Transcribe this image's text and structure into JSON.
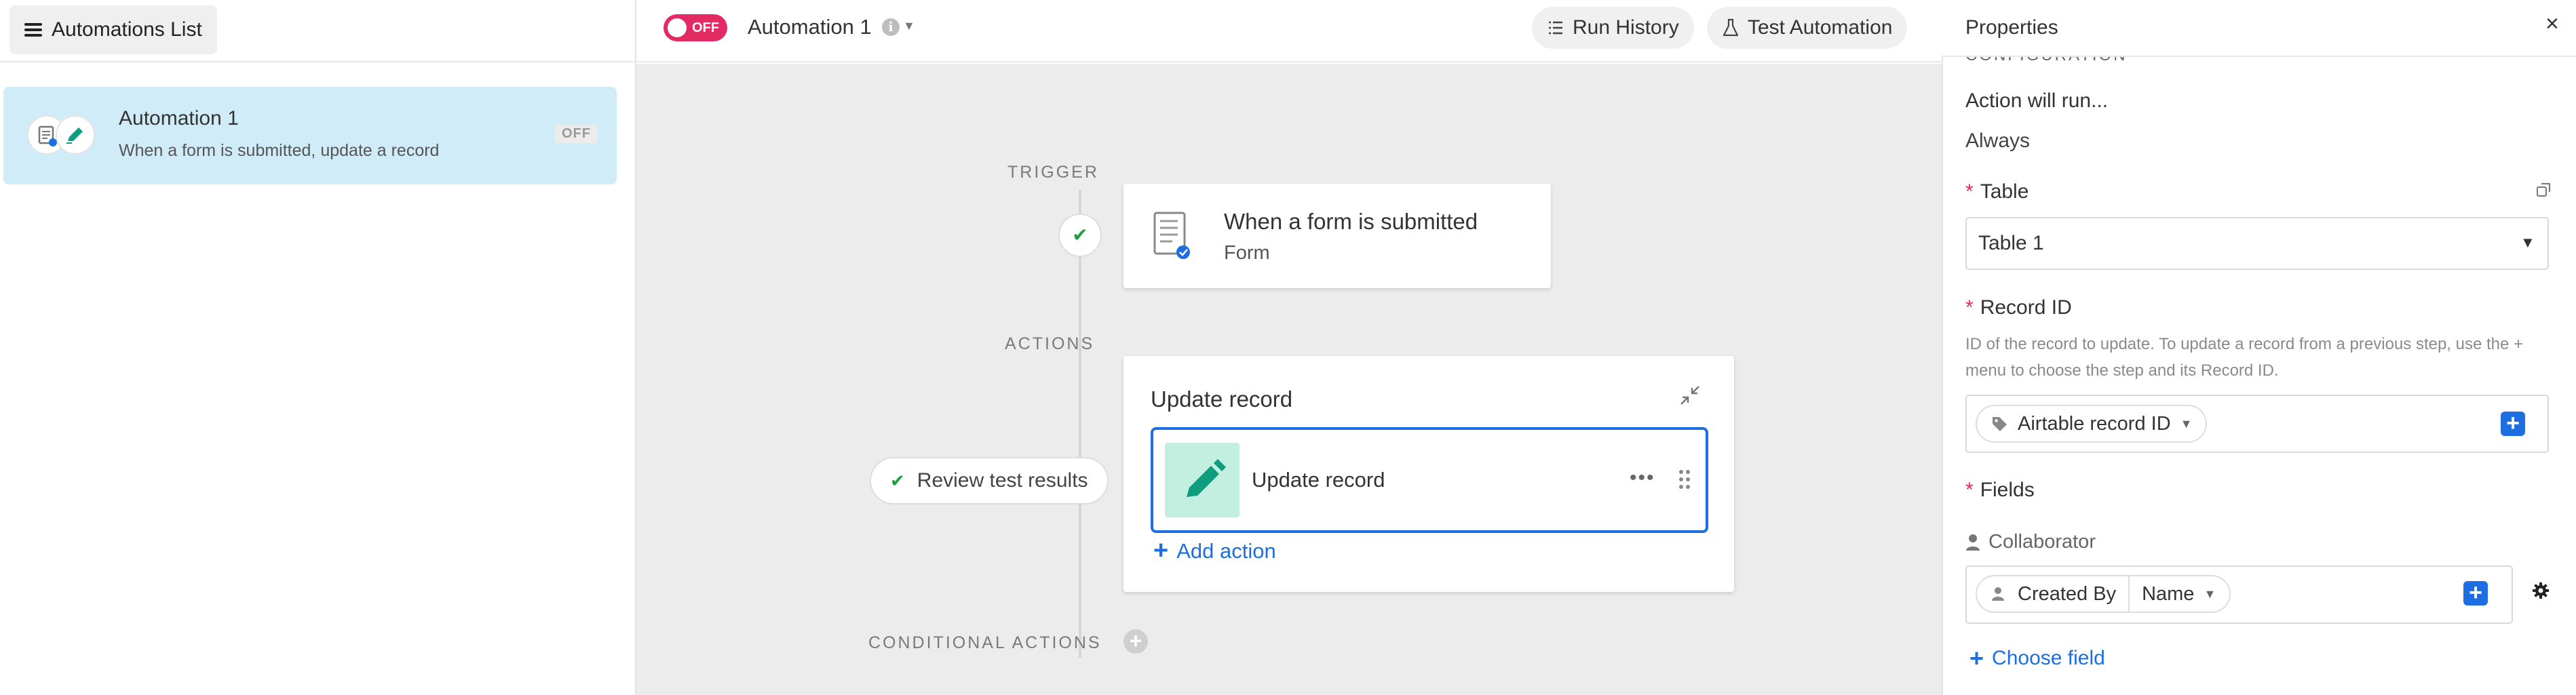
{
  "sidebar": {
    "list_button_label": "Automations List",
    "item": {
      "title": "Automation 1",
      "description": "When a form is submitted, update a record",
      "status_badge": "OFF"
    }
  },
  "topbar": {
    "toggle_label": "OFF",
    "automation_name": "Automation 1",
    "info_glyph": "i",
    "run_history_label": "Run History",
    "test_automation_label": "Test Automation"
  },
  "canvas": {
    "trigger_section": "TRIGGER",
    "actions_section": "ACTIONS",
    "conditional_section": "CONDITIONAL ACTIONS",
    "trigger_card": {
      "title": "When a form is submitted",
      "subtitle": "Form"
    },
    "review_button": "Review test results",
    "action_card": {
      "title": "Update record",
      "step_label": "Update record",
      "more_glyph": "•••"
    },
    "add_action_label": "Add action"
  },
  "properties": {
    "title": "Properties",
    "close_glyph": "×",
    "configuration_label": "CONFIGURATION",
    "action_run_label": "Action will run...",
    "action_run_value": "Always",
    "table": {
      "label": "Table",
      "value": "Table 1"
    },
    "record_id": {
      "label": "Record ID",
      "help": "ID of the record to update. To update a record from a previous step, use the + menu to choose the step and its Record ID.",
      "pill_label": "Airtable record ID"
    },
    "fields": {
      "label": "Fields",
      "collaborator_label": "Collaborator",
      "pill_label": "Created By",
      "pill_sub_label": "Name"
    },
    "choose_field_label": "Choose field",
    "required_mark": "*"
  },
  "colors": {
    "accent_blue": "#1d6ee1",
    "off_pink": "#e42a63",
    "selected_item_bg": "#d1ecf9",
    "success_green": "#1e9e3e",
    "pencil_tile_bg": "#c3efe0",
    "pencil_icon": "#0e9e7e"
  }
}
